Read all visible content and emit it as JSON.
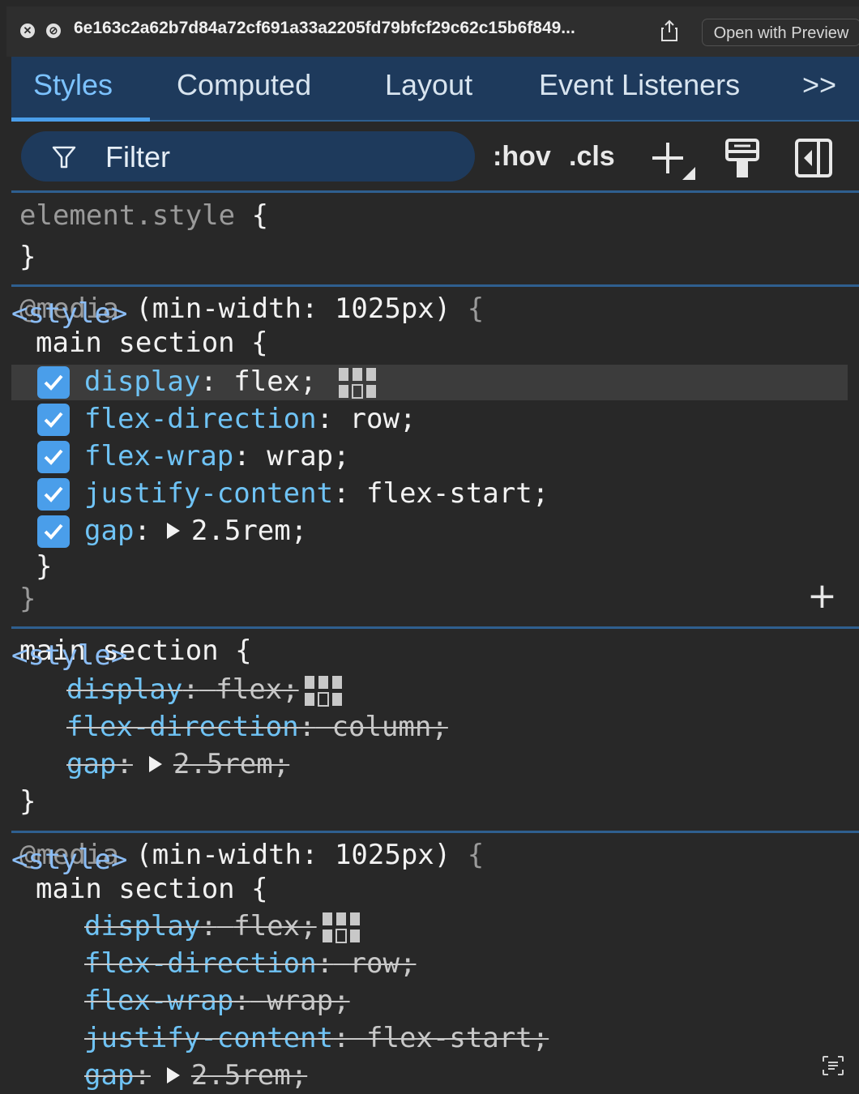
{
  "titlebar": {
    "filename": "6e163c2a62b7d84a72cf691a33a2205fd79bfcf29c62c15b6f849...",
    "open_with_preview": "Open with Preview",
    "close_glyph": "✕",
    "block_glyph": "⊘"
  },
  "tabs": {
    "styles": "Styles",
    "computed": "Computed",
    "layout": "Layout",
    "event_listeners": "Event Listeners",
    "more": ">>"
  },
  "toolbar": {
    "filter_label": "Filter",
    "hov": ":hov",
    "cls": ".cls"
  },
  "rules": {
    "element_style": {
      "selector": "element.style",
      "open": "{",
      "close": "}"
    },
    "media1": {
      "at": "@media",
      "query": "(min-width: 1025px)",
      "open_brace": "{",
      "selector": "main section {",
      "origin": "<style>",
      "decls": [
        {
          "prop": "display",
          "colon": ":",
          "value": "flex;"
        },
        {
          "prop": "flex-direction",
          "colon": ":",
          "value": "row;"
        },
        {
          "prop": "flex-wrap",
          "colon": ":",
          "value": "wrap;"
        },
        {
          "prop": "justify-content",
          "colon": ":",
          "value": "flex-start;"
        },
        {
          "prop": "gap",
          "colon": ":",
          "value": "2.5rem;"
        }
      ],
      "inner_close": "}",
      "outer_close": "}"
    },
    "main_section": {
      "selector": "main section {",
      "origin": "<style>",
      "decls": [
        {
          "prop": "display",
          "colon": ":",
          "value": "flex;"
        },
        {
          "prop": "flex-direction",
          "colon": ":",
          "value": "column;"
        },
        {
          "prop": "gap",
          "colon": ":",
          "value": "2.5rem;"
        }
      ],
      "close": "}"
    },
    "media2": {
      "at": "@media",
      "query": "(min-width: 1025px)",
      "open_brace": "{",
      "selector": "main section {",
      "origin": "<style>",
      "decls": [
        {
          "prop": "display",
          "colon": ":",
          "value": "flex;"
        },
        {
          "prop": "flex-direction",
          "colon": ":",
          "value": "row;"
        },
        {
          "prop": "flex-wrap",
          "colon": ":",
          "value": "wrap;"
        },
        {
          "prop": "justify-content",
          "colon": ":",
          "value": "flex-start;"
        },
        {
          "prop": "gap",
          "colon": ":",
          "value": "2.5rem;"
        }
      ]
    }
  },
  "colors": {
    "accent": "#4a9eea",
    "property": "#6fc3f5",
    "tabbar_bg": "#1e3a5c",
    "panel_bg": "#282828"
  },
  "icons": [
    "close-icon",
    "block-icon",
    "share-icon",
    "filter-icon",
    "plus-icon",
    "paintbrush-icon",
    "sidebar-toggle-icon",
    "flex-grid-icon",
    "checkmark-icon",
    "expand-triangle-icon",
    "text-recognition-icon"
  ]
}
